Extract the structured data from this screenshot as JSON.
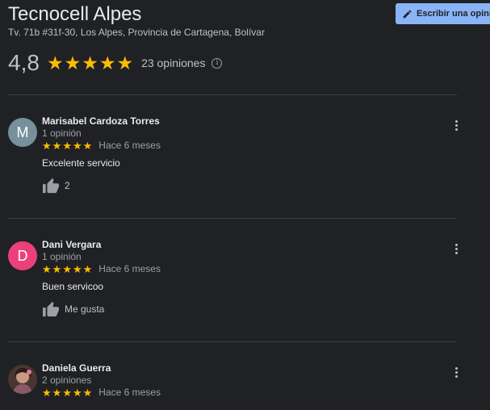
{
  "place": {
    "name": "Tecnocell Alpes",
    "address": "Tv. 71b #31f-30, Los Alpes, Provincia de Cartagena, Bolívar",
    "rating": "4,8",
    "review_count": "23 opiniones"
  },
  "write_review_label": "Escribir una opinión",
  "colors": {
    "star": "#fbbc04",
    "accent": "#8ab4f8",
    "avatar_m": "#78909c",
    "avatar_d": "#ec407a"
  },
  "reviews": [
    {
      "name": "Marisabel Cardoza Torres",
      "count": "1 opinión",
      "stars": 5,
      "date": "Hace 6 meses",
      "text": "Excelente servicio",
      "like_label": "2",
      "avatar_letter": "M"
    },
    {
      "name": "Dani Vergara",
      "count": "1 opinión",
      "stars": 5,
      "date": "Hace 6 meses",
      "text": "Buen servicoo",
      "like_label": "Me gusta",
      "avatar_letter": "D"
    },
    {
      "name": "Daniela Guerra",
      "count": "2 opiniones",
      "stars": 5,
      "date": "Hace 6 meses",
      "avatar_letter": ""
    }
  ]
}
